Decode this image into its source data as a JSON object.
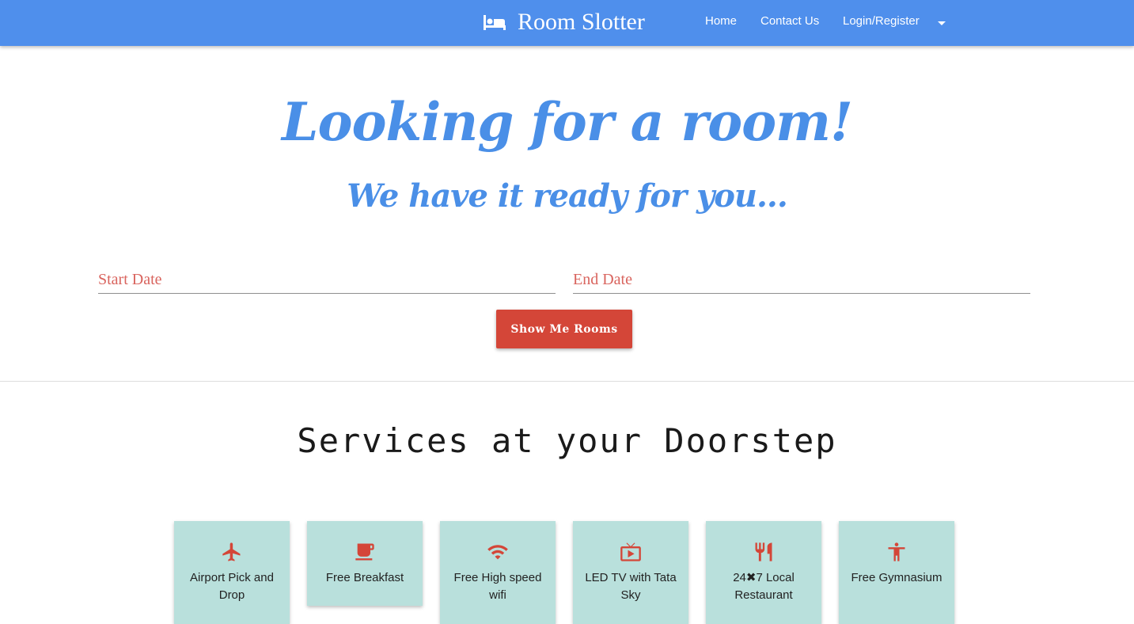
{
  "navbar": {
    "brand": "Room Slotter",
    "brand_icon": "bed-icon",
    "links": [
      "Home",
      "Contact Us",
      "Login/Register"
    ],
    "dropdown_icon": "caret-down-icon",
    "color": "#4f8fec"
  },
  "hero": {
    "title": "Looking for a room!",
    "subtitle": "We have it ready for you..."
  },
  "search": {
    "start_placeholder": "Start Date",
    "end_placeholder": "End Date",
    "button_label": "Show Me Rooms",
    "button_color": "#d44638"
  },
  "services": {
    "title": "Services at your Doorstep",
    "items": [
      {
        "label": "Airport Pick and Drop",
        "icon": "airplane-icon"
      },
      {
        "label": "Free Breakfast",
        "icon": "coffee-cup-icon"
      },
      {
        "label": "Free High speed wifi",
        "icon": "wifi-icon"
      },
      {
        "label": "LED TV with Tata Sky",
        "icon": "tv-icon"
      },
      {
        "label": "24✖7 Local Restaurant",
        "icon": "fork-knife-icon"
      },
      {
        "label": "Free Gymnasium",
        "icon": "person-icon"
      }
    ],
    "card_color": "#b9e0dc",
    "icon_color": "#d44638"
  }
}
